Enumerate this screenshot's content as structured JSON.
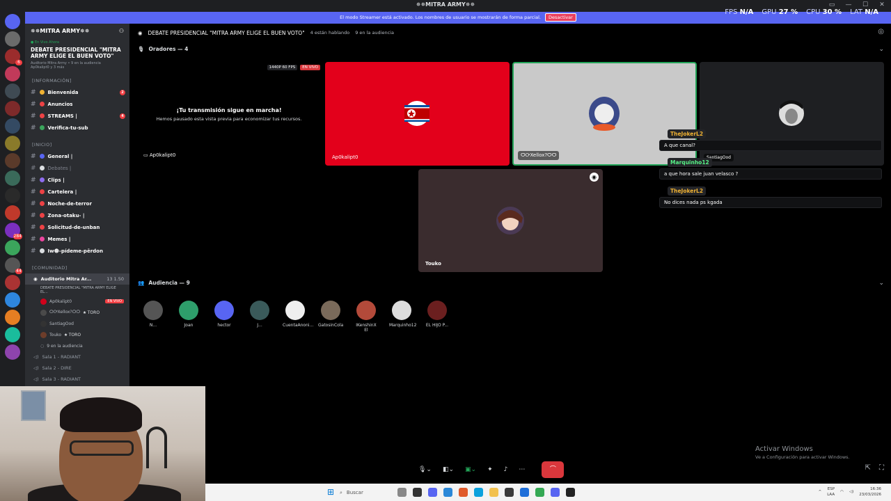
{
  "window": {
    "title": "✵✵MITRA ARMY✵✵"
  },
  "perf": [
    {
      "label": "FPS",
      "value": "N/A"
    },
    {
      "label": "GPU",
      "value": "27 %"
    },
    {
      "label": "CPU",
      "value": "30 %"
    },
    {
      "label": "LAT",
      "value": "N/A"
    }
  ],
  "streamer_banner": {
    "text": "El modo Streamer está activado. Los nombres de usuario se mostrarán de forma parcial.",
    "button": "Desactivar"
  },
  "server": {
    "name": "✵✵MITRA ARMY✵✵"
  },
  "live_card": {
    "tag": "● En Vivo Ahora",
    "title": "DEBATE PRESIDENCIAL \"MITRA ARMY ELIGE EL BUEN VOTO\"",
    "sub": "Auditorio Mitra Army • 9 en la audiencia",
    "sub2": "Ap0kalipt0 y 3 más"
  },
  "categories": {
    "info": "[INFORMACIÓN]",
    "inicio": "[INICIO]",
    "comunidad": "[COMUNIDAD]"
  },
  "channels_info": [
    {
      "label": "Bienvenida",
      "count": "2",
      "color": "#f0b232"
    },
    {
      "label": "Anuncios",
      "count": "",
      "color": "#ed4245"
    },
    {
      "label": "STREAMS |",
      "count": "4",
      "color": "#ed4245"
    },
    {
      "label": "Verifica-tu-sub",
      "count": "",
      "color": "#3ba55c"
    }
  ],
  "channels_inicio": [
    {
      "label": "General |",
      "muted": false,
      "color": "#5865f2"
    },
    {
      "label": "Debates |",
      "muted": true,
      "color": "#dbdee1"
    },
    {
      "label": "Clips |",
      "muted": false,
      "color": "#8e6cef"
    },
    {
      "label": "Cartelera |",
      "muted": false,
      "color": "#ed4245"
    },
    {
      "label": "Noche-de-terror",
      "muted": false,
      "color": "#ed4245"
    },
    {
      "label": "Zona-otaku- |",
      "muted": false,
      "color": "#ed4245"
    },
    {
      "label": "Solicitud-de-unban",
      "muted": false,
      "color": "#ed4245"
    },
    {
      "label": "Memes |",
      "muted": false,
      "color": "#eb459e"
    },
    {
      "label": "Iw☻-pídeme-pērdon",
      "muted": false,
      "color": "#dbdee1"
    }
  ],
  "voice": {
    "stage": "Auditorio Mitra Ar...",
    "stage_counts": "13   1.50",
    "stage_topic": "DEBATE PRESIDENCIAL \"MITRA ARMY ELIGE EL...",
    "users": [
      {
        "name": "Ap0kalipt0",
        "extra": "EN VIVO",
        "color": "#d0021b"
      },
      {
        "name": "ѺᎤXellox?ѺѺ",
        "extra": "🟊 TORO",
        "color": "#4a4a4a"
      },
      {
        "name": "SantiagOod",
        "extra": "",
        "color": "#333"
      },
      {
        "name": "Touko",
        "extra": "🟊 TORO",
        "color": "#6d3d2a"
      }
    ],
    "audience": "9 en la audiencia",
    "rooms": [
      "Sala 1 - RADIANT",
      "Sala 2 - DIRE",
      "Sala 3 - RADIANT"
    ]
  },
  "topbar": {
    "title": "DEBATE PRESIDENCIAL \"MITRA ARMY ELIGE EL BUEN VOTO\"",
    "talking": "4 están hablando",
    "audience": "9 en la audiencia"
  },
  "speakers": {
    "label": "Oradores — 4"
  },
  "my_stream": {
    "res": "1440P 60 FPS",
    "live": "EN VIVO",
    "line1": "¡Tu transmisión sigue en marcha!",
    "line2": "Hemos pausado esta vista previa para economizar tus recursos.",
    "name": "Ap0kalipt0"
  },
  "tiles": [
    {
      "name": "Ap0kalipt0"
    },
    {
      "name": "ѺᎤXellox?ѺѺ"
    },
    {
      "name": "SantiagOod"
    },
    {
      "name": "Touko"
    }
  ],
  "chat": [
    {
      "user": "TheJokerL2",
      "msg": "A que canal?"
    },
    {
      "user": "Marquinho12",
      "msg": "a que hora sale juan velasco ?"
    },
    {
      "user": "TheJokerL2",
      "msg": "No dices nada ps kgada"
    }
  ],
  "audience_section": {
    "label": "Audiencia — 9"
  },
  "audience": [
    {
      "name": "N...",
      "color": "#555"
    },
    {
      "name": "Joan",
      "color": "#2e9e6b"
    },
    {
      "name": "hector",
      "color": "#5865f2"
    },
    {
      "name": "J...",
      "color": "#3a5a5a"
    },
    {
      "name": "CuentaAnoni...",
      "color": "#eee"
    },
    {
      "name": "GatosinCola",
      "color": "#7a6a5a"
    },
    {
      "name": "IKenshinX El",
      "color": "#b34a3a"
    },
    {
      "name": "Marquinho12",
      "color": "#ddd"
    },
    {
      "name": "EL HIJO P...",
      "color": "#6b1f1f"
    }
  ],
  "activate_windows": {
    "title": "Activar Windows",
    "sub": "Ve a Configuración para activar Windows."
  },
  "taskbar": {
    "search": "Buscar",
    "lang": "ESP\nLAA",
    "time": "16:36",
    "date": "23/03/2026"
  }
}
